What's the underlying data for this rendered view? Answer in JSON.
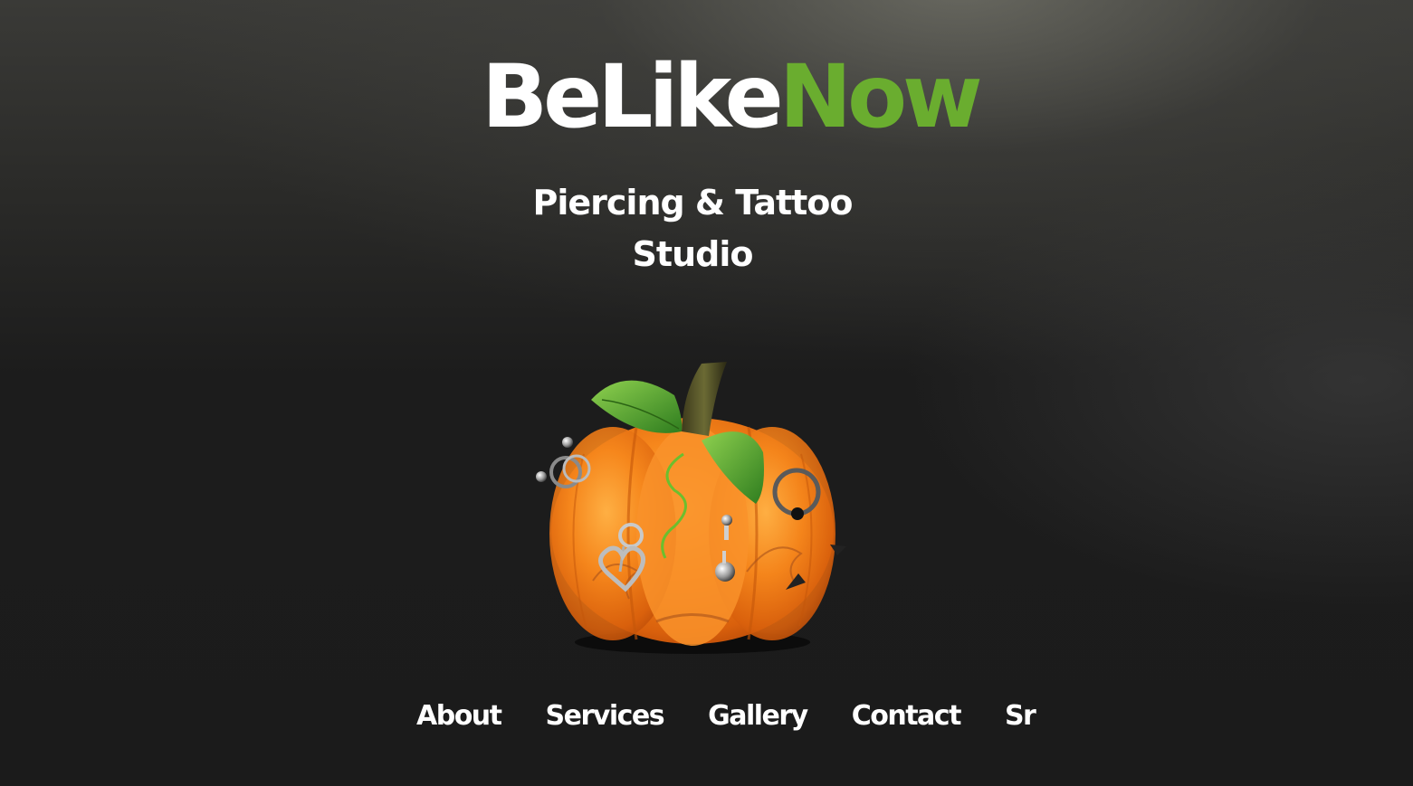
{
  "logo": {
    "part_be": "Be",
    "part_like": "Like",
    "part_now": "Now",
    "color_primary": "#ffffff",
    "color_accent": "#6aad2f"
  },
  "tagline": {
    "line1": "Piercing & Tattoo",
    "line2": "Studio"
  },
  "hero_image": {
    "icon": "pierced-pumpkin-icon"
  },
  "nav": {
    "items": [
      {
        "label": "About"
      },
      {
        "label": "Services"
      },
      {
        "label": "Gallery"
      },
      {
        "label": "Contact"
      },
      {
        "label": "Sr"
      }
    ]
  }
}
